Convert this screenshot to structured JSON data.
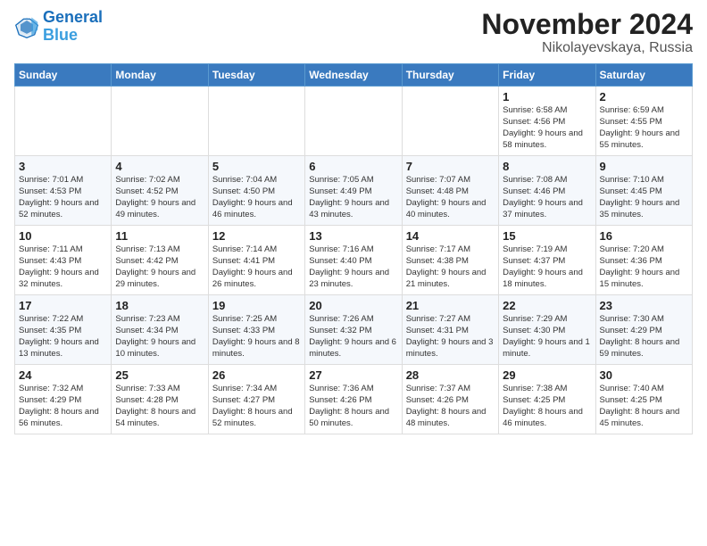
{
  "logo": {
    "line1": "General",
    "line2": "Blue"
  },
  "title": "November 2024",
  "subtitle": "Nikolayevskaya, Russia",
  "weekdays": [
    "Sunday",
    "Monday",
    "Tuesday",
    "Wednesday",
    "Thursday",
    "Friday",
    "Saturday"
  ],
  "weeks": [
    [
      {
        "day": "",
        "text": ""
      },
      {
        "day": "",
        "text": ""
      },
      {
        "day": "",
        "text": ""
      },
      {
        "day": "",
        "text": ""
      },
      {
        "day": "",
        "text": ""
      },
      {
        "day": "1",
        "text": "Sunrise: 6:58 AM\nSunset: 4:56 PM\nDaylight: 9 hours and 58 minutes."
      },
      {
        "day": "2",
        "text": "Sunrise: 6:59 AM\nSunset: 4:55 PM\nDaylight: 9 hours and 55 minutes."
      }
    ],
    [
      {
        "day": "3",
        "text": "Sunrise: 7:01 AM\nSunset: 4:53 PM\nDaylight: 9 hours and 52 minutes."
      },
      {
        "day": "4",
        "text": "Sunrise: 7:02 AM\nSunset: 4:52 PM\nDaylight: 9 hours and 49 minutes."
      },
      {
        "day": "5",
        "text": "Sunrise: 7:04 AM\nSunset: 4:50 PM\nDaylight: 9 hours and 46 minutes."
      },
      {
        "day": "6",
        "text": "Sunrise: 7:05 AM\nSunset: 4:49 PM\nDaylight: 9 hours and 43 minutes."
      },
      {
        "day": "7",
        "text": "Sunrise: 7:07 AM\nSunset: 4:48 PM\nDaylight: 9 hours and 40 minutes."
      },
      {
        "day": "8",
        "text": "Sunrise: 7:08 AM\nSunset: 4:46 PM\nDaylight: 9 hours and 37 minutes."
      },
      {
        "day": "9",
        "text": "Sunrise: 7:10 AM\nSunset: 4:45 PM\nDaylight: 9 hours and 35 minutes."
      }
    ],
    [
      {
        "day": "10",
        "text": "Sunrise: 7:11 AM\nSunset: 4:43 PM\nDaylight: 9 hours and 32 minutes."
      },
      {
        "day": "11",
        "text": "Sunrise: 7:13 AM\nSunset: 4:42 PM\nDaylight: 9 hours and 29 minutes."
      },
      {
        "day": "12",
        "text": "Sunrise: 7:14 AM\nSunset: 4:41 PM\nDaylight: 9 hours and 26 minutes."
      },
      {
        "day": "13",
        "text": "Sunrise: 7:16 AM\nSunset: 4:40 PM\nDaylight: 9 hours and 23 minutes."
      },
      {
        "day": "14",
        "text": "Sunrise: 7:17 AM\nSunset: 4:38 PM\nDaylight: 9 hours and 21 minutes."
      },
      {
        "day": "15",
        "text": "Sunrise: 7:19 AM\nSunset: 4:37 PM\nDaylight: 9 hours and 18 minutes."
      },
      {
        "day": "16",
        "text": "Sunrise: 7:20 AM\nSunset: 4:36 PM\nDaylight: 9 hours and 15 minutes."
      }
    ],
    [
      {
        "day": "17",
        "text": "Sunrise: 7:22 AM\nSunset: 4:35 PM\nDaylight: 9 hours and 13 minutes."
      },
      {
        "day": "18",
        "text": "Sunrise: 7:23 AM\nSunset: 4:34 PM\nDaylight: 9 hours and 10 minutes."
      },
      {
        "day": "19",
        "text": "Sunrise: 7:25 AM\nSunset: 4:33 PM\nDaylight: 9 hours and 8 minutes."
      },
      {
        "day": "20",
        "text": "Sunrise: 7:26 AM\nSunset: 4:32 PM\nDaylight: 9 hours and 6 minutes."
      },
      {
        "day": "21",
        "text": "Sunrise: 7:27 AM\nSunset: 4:31 PM\nDaylight: 9 hours and 3 minutes."
      },
      {
        "day": "22",
        "text": "Sunrise: 7:29 AM\nSunset: 4:30 PM\nDaylight: 9 hours and 1 minute."
      },
      {
        "day": "23",
        "text": "Sunrise: 7:30 AM\nSunset: 4:29 PM\nDaylight: 8 hours and 59 minutes."
      }
    ],
    [
      {
        "day": "24",
        "text": "Sunrise: 7:32 AM\nSunset: 4:29 PM\nDaylight: 8 hours and 56 minutes."
      },
      {
        "day": "25",
        "text": "Sunrise: 7:33 AM\nSunset: 4:28 PM\nDaylight: 8 hours and 54 minutes."
      },
      {
        "day": "26",
        "text": "Sunrise: 7:34 AM\nSunset: 4:27 PM\nDaylight: 8 hours and 52 minutes."
      },
      {
        "day": "27",
        "text": "Sunrise: 7:36 AM\nSunset: 4:26 PM\nDaylight: 8 hours and 50 minutes."
      },
      {
        "day": "28",
        "text": "Sunrise: 7:37 AM\nSunset: 4:26 PM\nDaylight: 8 hours and 48 minutes."
      },
      {
        "day": "29",
        "text": "Sunrise: 7:38 AM\nSunset: 4:25 PM\nDaylight: 8 hours and 46 minutes."
      },
      {
        "day": "30",
        "text": "Sunrise: 7:40 AM\nSunset: 4:25 PM\nDaylight: 8 hours and 45 minutes."
      }
    ]
  ]
}
